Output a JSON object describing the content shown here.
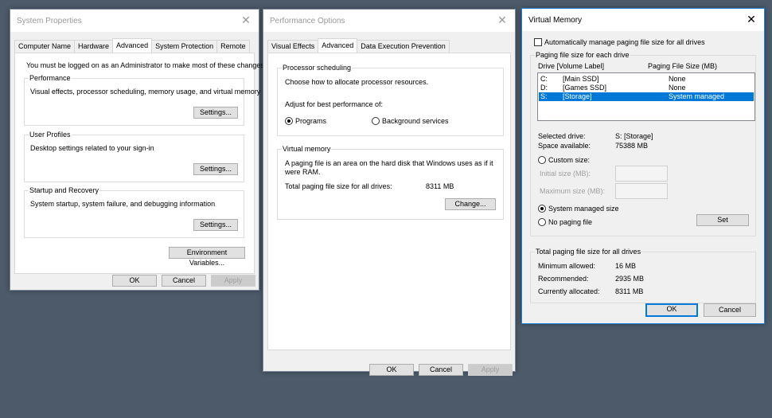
{
  "sysprops": {
    "title": "System Properties",
    "tabs": [
      "Computer Name",
      "Hardware",
      "Advanced",
      "System Protection",
      "Remote"
    ],
    "notice": "You must be logged on as an Administrator to make most of these changes.",
    "performance": {
      "title": "Performance",
      "desc": "Visual effects, processor scheduling, memory usage, and virtual memory",
      "button": "Settings..."
    },
    "profiles": {
      "title": "User Profiles",
      "desc": "Desktop settings related to your sign-in",
      "button": "Settings..."
    },
    "startup": {
      "title": "Startup and Recovery",
      "desc": "System startup, system failure, and debugging information",
      "button": "Settings..."
    },
    "env_button": "Environment Variables...",
    "ok": "OK",
    "cancel": "Cancel",
    "apply": "Apply"
  },
  "perfopts": {
    "title": "Performance Options",
    "tabs": [
      "Visual Effects",
      "Advanced",
      "Data Execution Prevention"
    ],
    "sched": {
      "title": "Processor scheduling",
      "desc": "Choose how to allocate processor resources.",
      "adjust": "Adjust for best performance of:",
      "opt_programs": "Programs",
      "opt_background": "Background services"
    },
    "vm": {
      "title": "Virtual memory",
      "desc": "A paging file is an area on the hard disk that Windows uses as if it were RAM.",
      "total_label": "Total paging file size for all drives:",
      "total_value": "8311 MB",
      "change_button": "Change..."
    },
    "ok": "OK",
    "cancel": "Cancel",
    "apply": "Apply"
  },
  "vmem": {
    "title": "Virtual Memory",
    "auto_label": "Automatically manage paging file size for all drives",
    "per_drive_title": "Paging file size for each drive",
    "col_drive": "Drive  [Volume Label]",
    "col_size": "Paging File Size (MB)",
    "drives": [
      {
        "letter": "C:",
        "label": "[Main SSD]",
        "size": "None"
      },
      {
        "letter": "D:",
        "label": "[Games SSD]",
        "size": "None"
      },
      {
        "letter": "S:",
        "label": "[Storage]",
        "size": "System managed"
      }
    ],
    "selected_drive_label": "Selected drive:",
    "selected_drive_value": "S:  [Storage]",
    "space_label": "Space available:",
    "space_value": "75388 MB",
    "custom_size": "Custom size:",
    "initial_size": "Initial size (MB):",
    "max_size": "Maximum size (MB):",
    "system_managed": "System managed size",
    "no_paging": "No paging file",
    "set_button": "Set",
    "totals_title": "Total paging file size for all drives",
    "min_label": "Minimum allowed:",
    "min_value": "16 MB",
    "rec_label": "Recommended:",
    "rec_value": "2935 MB",
    "cur_label": "Currently allocated:",
    "cur_value": "8311 MB",
    "ok": "OK",
    "cancel": "Cancel"
  },
  "icons": {
    "close": "close-icon"
  }
}
